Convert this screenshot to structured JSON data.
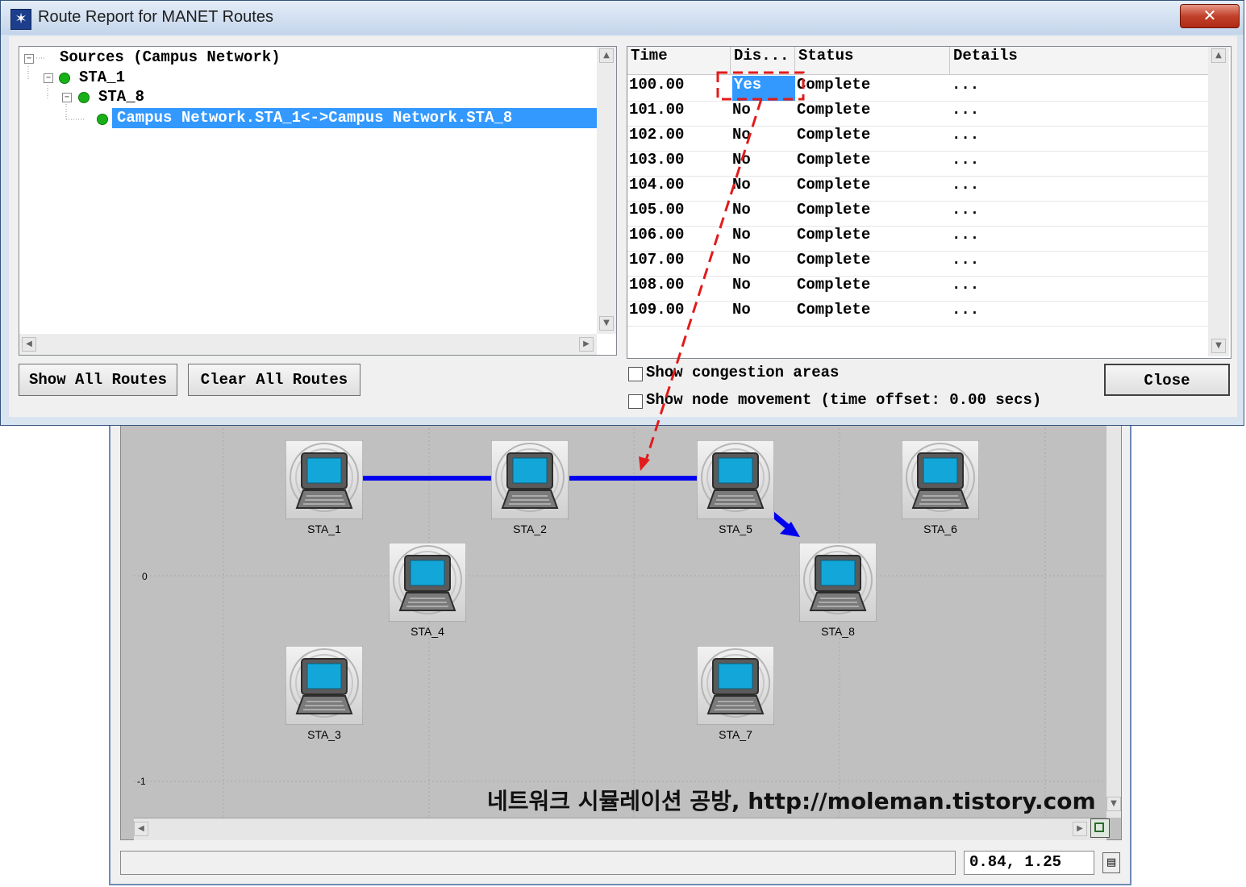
{
  "dialog": {
    "title": "Route Report for MANET Routes",
    "close_glyph": "✕",
    "tree": {
      "root": "Sources (Campus Network)",
      "level1": "STA_1",
      "level2": "STA_8",
      "selected": "Campus Network.STA_1<->Campus Network.STA_8"
    },
    "table": {
      "headers": [
        "Time",
        "Dis...",
        "Status",
        "Details"
      ],
      "rows": [
        {
          "time": "100.00",
          "dis": "Yes",
          "status": "Complete",
          "details": "..."
        },
        {
          "time": "101.00",
          "dis": "No",
          "status": "Complete",
          "details": "..."
        },
        {
          "time": "102.00",
          "dis": "No",
          "status": "Complete",
          "details": "..."
        },
        {
          "time": "103.00",
          "dis": "No",
          "status": "Complete",
          "details": "..."
        },
        {
          "time": "104.00",
          "dis": "No",
          "status": "Complete",
          "details": "..."
        },
        {
          "time": "105.00",
          "dis": "No",
          "status": "Complete",
          "details": "..."
        },
        {
          "time": "106.00",
          "dis": "No",
          "status": "Complete",
          "details": "..."
        },
        {
          "time": "107.00",
          "dis": "No",
          "status": "Complete",
          "details": "..."
        },
        {
          "time": "108.00",
          "dis": "No",
          "status": "Complete",
          "details": "..."
        },
        {
          "time": "109.00",
          "dis": "No",
          "status": "Complete",
          "details": "..."
        }
      ]
    },
    "buttons": {
      "show_all": "Show All Routes",
      "clear_all": "Clear All Routes",
      "close": "Close"
    },
    "checkboxes": {
      "congestion": "Show congestion areas",
      "movement": "Show node movement (time offset: 0.00 secs)"
    }
  },
  "map": {
    "nodes": [
      "STA_1",
      "STA_2",
      "STA_5",
      "STA_6",
      "STA_4",
      "STA_8",
      "STA_3",
      "STA_7"
    ],
    "axis_labels": [
      "0",
      "-1"
    ],
    "coordinates": "0.84, 1.25",
    "watermark": "네트워크 시뮬레이션 공방, http://moleman.tistory.com"
  },
  "colors": {
    "route_line": "#0000ee",
    "annotation": "#e21b1b",
    "selection": "#3399ff",
    "node_dot": "#17b117"
  }
}
